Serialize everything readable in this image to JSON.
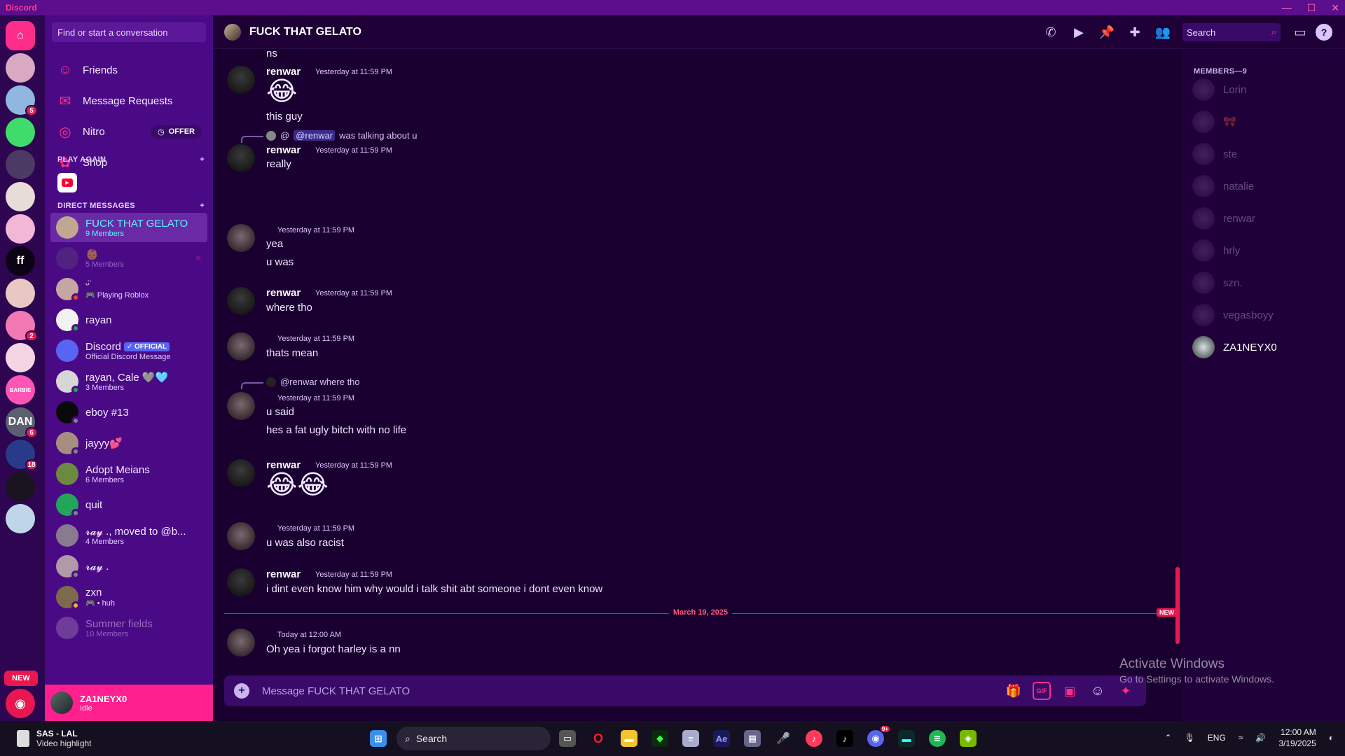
{
  "window": {
    "app_name": "Discord",
    "controls": [
      "—",
      "☐",
      "✕"
    ]
  },
  "servers": [
    {
      "id": "home",
      "label": "⌂",
      "color": "#ff2d8a"
    },
    {
      "id": "s1",
      "label": "",
      "color": "#d8a9c0"
    },
    {
      "id": "s2",
      "label": "",
      "color": "#8fb7e0",
      "badge": "5"
    },
    {
      "id": "s3",
      "label": "",
      "color": "#3fdc6c"
    },
    {
      "id": "s4",
      "label": "",
      "color": "#4b3a63"
    },
    {
      "id": "s5",
      "label": "",
      "color": "#e7dcd8"
    },
    {
      "id": "s6",
      "label": "",
      "color": "#f2b6d6"
    },
    {
      "id": "s7",
      "label": "ff",
      "color": "#0c0414"
    },
    {
      "id": "s8",
      "label": "",
      "color": "#e8c8c2"
    },
    {
      "id": "s9",
      "label": "",
      "color": "#f279b4",
      "badge": "2"
    },
    {
      "id": "s10",
      "label": "",
      "color": "#f5d4e4"
    },
    {
      "id": "s11",
      "label": "BARBIE",
      "color": "#ff55b5"
    },
    {
      "id": "s12",
      "label": "DAN",
      "color": "#5a6070",
      "badge": "6"
    },
    {
      "id": "s13",
      "label": "",
      "color": "#2a3a8a",
      "badge": "18"
    },
    {
      "id": "s14",
      "label": "",
      "color": "#1a1420"
    },
    {
      "id": "s15",
      "label": "",
      "color": "#bfd6e8"
    }
  ],
  "rail": {
    "new_label": "NEW",
    "explore_icon": "compass-icon"
  },
  "sidebar": {
    "find_placeholder": "Find or start a conversation",
    "nav": [
      {
        "label": "Friends",
        "icon": "friends-icon",
        "glyph": "☺"
      },
      {
        "label": "Message Requests",
        "icon": "mail-icon",
        "glyph": "✉"
      },
      {
        "label": "Nitro",
        "icon": "nitro-icon",
        "glyph": "◎",
        "badge": "OFFER"
      },
      {
        "label": "Shop",
        "icon": "shop-icon",
        "glyph": "✿"
      }
    ],
    "play_again": "PLAY AGAIN",
    "direct_messages": "DIRECT MESSAGES",
    "dms": [
      {
        "name": "FUCK THAT GELATO",
        "sub": "9 Members",
        "color": "#bfa88f",
        "active": true
      },
      {
        "name": "👶",
        "sub": "5 Members",
        "color": "#5b3f7a",
        "faded": true
      },
      {
        "name": "ᵕ̈",
        "sub": "🎮 Playing Roblox",
        "color": "#c6a6a0",
        "status": "#f23f43"
      },
      {
        "name": "rayan",
        "sub": "",
        "color": "#f2f2f2",
        "status": "#23a55a"
      },
      {
        "name": "Discord",
        "sub": "Official Discord Message",
        "color": "#5865f2",
        "official": "✓ OFFICIAL"
      },
      {
        "name": "rayan, Cale 🩶🩵",
        "sub": "3 Members",
        "color": "#d6d6d6",
        "status": "#23a55a"
      },
      {
        "name": "eboy #13",
        "sub": "",
        "color": "#0a0a0a",
        "status": "#80848e"
      },
      {
        "name": "jayyy💕",
        "sub": "",
        "color": "#a58e80",
        "status": "#80848e"
      },
      {
        "name": "Adopt Meians",
        "sub": "6 Members",
        "color": "#6b8a40"
      },
      {
        "name": "quit",
        "sub": "",
        "color": "#23a55a",
        "status": "#80848e"
      },
      {
        "name": "𝓻𝓪𝔂 ., moved to @b...",
        "sub": "4 Members",
        "color": "#8a7a90"
      },
      {
        "name": "𝓻𝓪𝔂 .",
        "sub": "",
        "color": "#b09aa8",
        "status": "#80848e"
      },
      {
        "name": "zxn",
        "sub": "🎮 • huh",
        "color": "#7d6a4c",
        "status": "#f0b232"
      },
      {
        "name": "Summer fields",
        "sub": "10 Members",
        "color": "#9a7ab0",
        "faded": true
      }
    ]
  },
  "user": {
    "name": "ZA1NEYX0",
    "status": "Idle"
  },
  "header": {
    "title": "FUCK THAT GELATO",
    "search_placeholder": "Search",
    "icons": [
      {
        "name": "call-icon",
        "g": "✆"
      },
      {
        "name": "video-icon",
        "g": "▶"
      },
      {
        "name": "pin-icon",
        "g": "📌"
      },
      {
        "name": "add-member-icon",
        "g": "✚"
      },
      {
        "name": "members-icon",
        "g": "👥"
      }
    ],
    "inbox_icon": "▭",
    "help_icon": "?"
  },
  "messages": {
    "m0": {
      "text": "ns"
    },
    "m1": {
      "author": "renwar",
      "ts": "Yesterday at 11:59 PM",
      "emoji": "😂",
      "text": "this guy"
    },
    "m2": {
      "reply_at": "@",
      "reply_mention": "@renwar",
      "reply_text": "was talking about u",
      "author": "renwar",
      "ts": "Yesterday at 11:59 PM",
      "text": "really"
    },
    "m3": {
      "ts": "Yesterday at 11:59 PM",
      "l1": "yea",
      "l2": "u was"
    },
    "m4": {
      "author": "renwar",
      "ts": "Yesterday at 11:59 PM",
      "text": "where tho"
    },
    "m5": {
      "ts": "Yesterday at 11:59 PM",
      "text": "thats mean"
    },
    "m6": {
      "reply": "@renwar where tho",
      "ts": "Yesterday at 11:59 PM",
      "l1": "u said",
      "l2": "hes a fat ugly bitch with no life"
    },
    "m7": {
      "author": "renwar",
      "ts": "Yesterday at 11:59 PM",
      "emoji": "😂😂"
    },
    "m8": {
      "ts": "Yesterday at 11:59 PM",
      "text": "u was also racist"
    },
    "m9": {
      "author": "renwar",
      "ts": "Yesterday at 11:59 PM",
      "text": "i dint even know him why would i talk shit abt someone i dont even know"
    },
    "divider": {
      "date": "March 19, 2025",
      "new": "NEW"
    },
    "m10": {
      "ts": "Today at 12:00 AM",
      "text": "Oh yea i forgot harley is a nn"
    }
  },
  "composer": {
    "placeholder": "Message FUCK THAT GELATO",
    "gif": "GIF"
  },
  "members": {
    "header": "MEMBERS—9",
    "list": [
      {
        "name": "Lorin"
      },
      {
        "name": "🎀"
      },
      {
        "name": "ste"
      },
      {
        "name": "natalie"
      },
      {
        "name": "renwar"
      },
      {
        "name": "hrly"
      },
      {
        "name": "szn."
      },
      {
        "name": "vegasboyy"
      },
      {
        "name": "ZA1NEYX0",
        "online": true
      }
    ]
  },
  "watermark": {
    "l1": "Activate Windows",
    "l2": "Go to Settings to activate Windows."
  },
  "taskbar": {
    "game": "SAS - LAL",
    "sub": "Video highlight",
    "search": "Search",
    "lang": "ENG",
    "time": "12:00 AM",
    "date": "3/19/2025",
    "discord_badge": "9+"
  }
}
